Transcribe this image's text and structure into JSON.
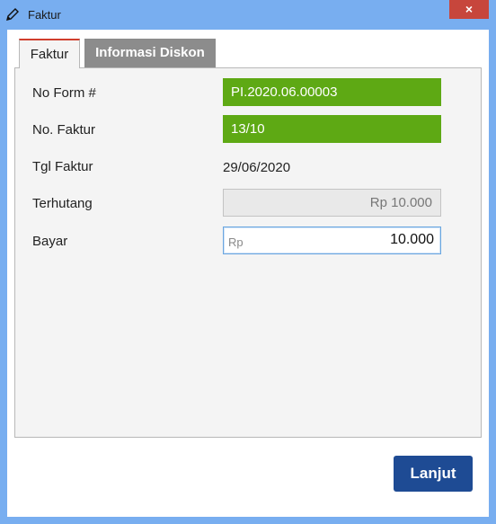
{
  "window": {
    "title": "Faktur",
    "close_label": "×",
    "icon": "pencil-icon"
  },
  "tabs": [
    {
      "label": "Faktur",
      "active": true
    },
    {
      "label": "Informasi Diskon",
      "active": false
    }
  ],
  "form": {
    "no_form": {
      "label": "No Form #",
      "value": "PI.2020.06.00003"
    },
    "no_faktur": {
      "label": "No. Faktur",
      "value": "13/10"
    },
    "tgl_faktur": {
      "label": "Tgl Faktur",
      "value": "29/06/2020"
    },
    "terhutang": {
      "label": "Terhutang",
      "value": "Rp 10.000"
    },
    "bayar": {
      "label": "Bayar",
      "prefix": "Rp",
      "value": "10.000"
    }
  },
  "actions": {
    "next_label": "Lanjut"
  },
  "colors": {
    "titlebar": "#78aef0",
    "close": "#c7463c",
    "green_field": "#5ea914",
    "primary_button": "#1e4b94",
    "active_tab_accent": "#d03e2d",
    "inactive_tab": "#8c8c8c"
  }
}
